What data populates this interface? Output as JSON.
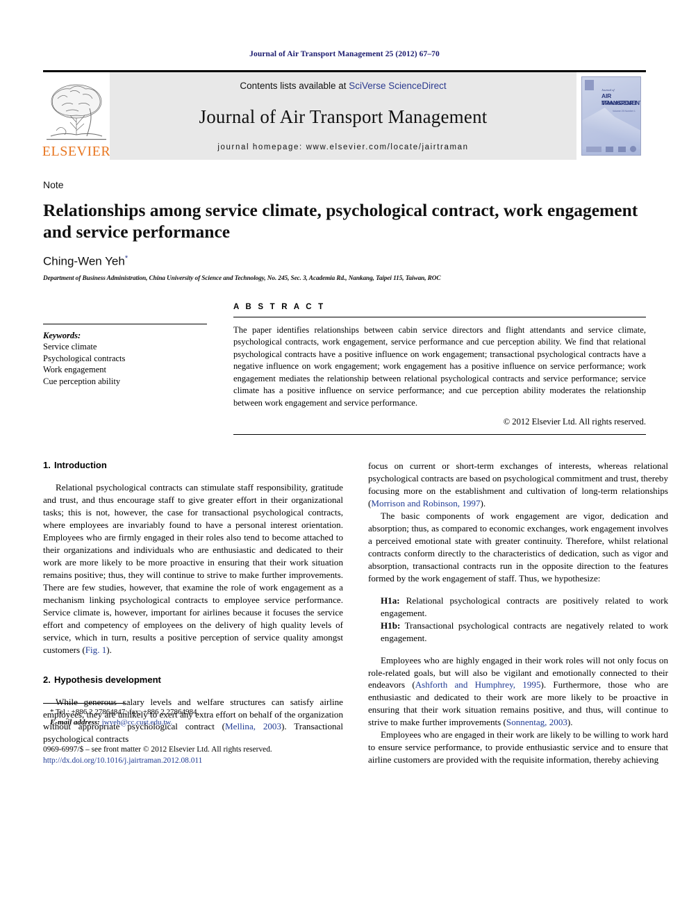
{
  "running_head": "Journal of Air Transport Management 25 (2012) 67–70",
  "masthead": {
    "contents_prefix": "Contents lists available at ",
    "contents_brand": "SciVerse ScienceDirect",
    "journal_title": "Journal of Air Transport Management",
    "homepage": "journal homepage: www.elsevier.com/locate/jairtraman",
    "publisher_wordmark": "ELSEVIER",
    "cover": {
      "journal_of": "Journal of",
      "title_line1": "AIR TRANSPORT",
      "title_line2": "MANAGEMENT",
      "subtitle": "Volume 25 Number 1"
    }
  },
  "article": {
    "type_label": "Note",
    "title": "Relationships among service climate, psychological contract, work engagement and service performance",
    "author": "Ching-Wen Yeh",
    "author_marker": "*",
    "affiliation": "Department of Business Administration, China University of Science and Technology, No. 245, Sec. 3, Academia Rd., Nankang, Taipei 115, Taiwan, ROC"
  },
  "keywords": {
    "heading": "Keywords:",
    "items": [
      "Service climate",
      "Psychological contracts",
      "Work engagement",
      "Cue perception ability"
    ]
  },
  "abstract": {
    "heading": "A B S T R A C T",
    "text": "The paper identifies relationships between cabin service directors and flight attendants and service climate, psychological contracts, work engagement, service performance and cue perception ability. We find that relational psychological contracts have a positive influence on work engagement; transactional psychological contracts have a negative influence on work engagement; work engagement has a positive influence on service performance; work engagement mediates the relationship between relational psychological contracts and service performance; service climate has a positive influence on service performance; and cue perception ability moderates the relationship between work engagement and service performance.",
    "copyright": "© 2012 Elsevier Ltd. All rights reserved."
  },
  "sections": {
    "introduction": {
      "number": "1.",
      "title": "Introduction",
      "paragraph_1_a": "Relational psychological contracts can stimulate staff responsibility, gratitude and trust, and thus encourage staff to give greater effort in their organizational tasks; this is not, however, the case for transactional psychological contracts, where employees are invariably found to have a personal interest orientation. Employees who are firmly engaged in their roles also tend to become attached to their organizations and individuals who are enthusiastic and dedicated to their work are more likely to be more proactive in ensuring that their work situation remains positive; thus, they will continue to strive to make further improvements. There are few studies, however, that examine the role of work engagement as a mechanism linking psychological contracts to employee service performance. Service climate is, however, important for airlines because it focuses the service effort and competency of employees on the delivery of high quality levels of service, which in turn, results a positive perception of service quality amongst customers (",
      "paragraph_1_link": "Fig. 1",
      "paragraph_1_b": ")."
    },
    "hypothesis": {
      "number": "2.",
      "title": "Hypothesis development",
      "paragraph_1_a": "While generous salary levels and welfare structures can satisfy airline employees, they are unlikely to exert any extra effort on behalf of the organization without appropriate psychological contract (",
      "paragraph_1_cite": "Mellina, 2003",
      "paragraph_1_b": "). Transactional psychological contracts"
    }
  },
  "right_column": {
    "para_1_a": "focus on current or short-term exchanges of interests, whereas relational psychological contracts are based on psychological commitment and trust, thereby focusing more on the establishment and cultivation of long-term relationships (",
    "para_1_cite": "Morrison and Robinson, 1997",
    "para_1_b": ").",
    "para_2": "The basic components of work engagement are vigor, dedication and absorption; thus, as compared to economic exchanges, work engagement involves a perceived emotional state with greater continuity. Therefore, whilst relational contracts conform directly to the characteristics of dedication, such as vigor and absorption, transactional contracts run in the opposite direction to the features formed by the work engagement of staff. Thus, we hypothesize:",
    "hypotheses": [
      {
        "label": "H1a:",
        "text": " Relational psychological contracts are positively related to work engagement."
      },
      {
        "label": "H1b:",
        "text": " Transactional psychological contracts are negatively related to work engagement."
      }
    ],
    "para_3_a": "Employees who are highly engaged in their work roles will not only focus on role-related goals, but will also be vigilant and emotionally connected to their endeavors (",
    "para_3_cite": "Ashforth and Humphrey, 1995",
    "para_3_b": "). Furthermore, those who are enthusiastic and dedicated to their work are more likely to be proactive in ensuring that their work situation remains positive, and thus, will continue to strive to make further improvements (",
    "para_3_cite2": "Sonnentag, 2003",
    "para_3_c": ").",
    "para_4": "Employees who are engaged in their work are likely to be willing to work hard to ensure service performance, to provide enthusiastic service and to ensure that airline customers are provided with the requisite information, thereby achieving"
  },
  "footnote": {
    "tel": "* Tel.: +886 2 27864847; fax: +886 2 27864984.",
    "email_label": "E-mail address:",
    "email": "jwyeh@cc.cust.edu.tw."
  },
  "footer": {
    "issn_line": "0969-6997/$ – see front matter © 2012 Elsevier Ltd. All rights reserved.",
    "doi": "http://dx.doi.org/10.1016/j.jairtraman.2012.08.011"
  },
  "colors": {
    "link_blue": "#1f3a93",
    "brand_blue": "#2b3a8f",
    "elsevier_orange": "#E87722",
    "masthead_gray": "#e8e8e8"
  }
}
